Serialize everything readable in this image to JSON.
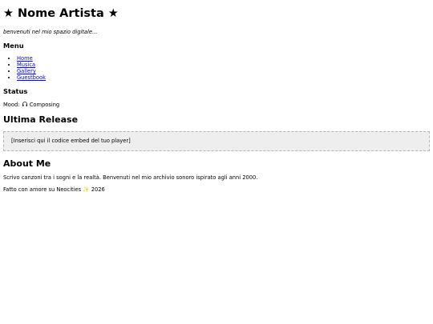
{
  "header": {
    "title": "★ Nome Artista ★",
    "tagline": "benvenuti nel mio spazio digitale..."
  },
  "menu": {
    "heading": "Menu",
    "items": [
      {
        "label": "Home"
      },
      {
        "label": "Musica"
      },
      {
        "label": "Gallery"
      },
      {
        "label": "Guestbook"
      }
    ],
    "link_color": "#0000ee"
  },
  "status": {
    "heading": "Status",
    "mood_label": "Mood:",
    "mood_icon": "headphones-icon",
    "mood_value": "Composing"
  },
  "release": {
    "heading": "Ultima Release",
    "embed_placeholder": "[Inserisci qui il codice embed del tuo player]"
  },
  "about": {
    "heading": "About Me",
    "text": "Scrivo canzoni tra i sogni e la realtà. Benvenuti nel mio archivio sonoro ispirato agli anni 2000."
  },
  "footer": {
    "text_before": "Fatto con amore su Neocities",
    "icon": "sparkles-icon",
    "text_after": "2026"
  }
}
